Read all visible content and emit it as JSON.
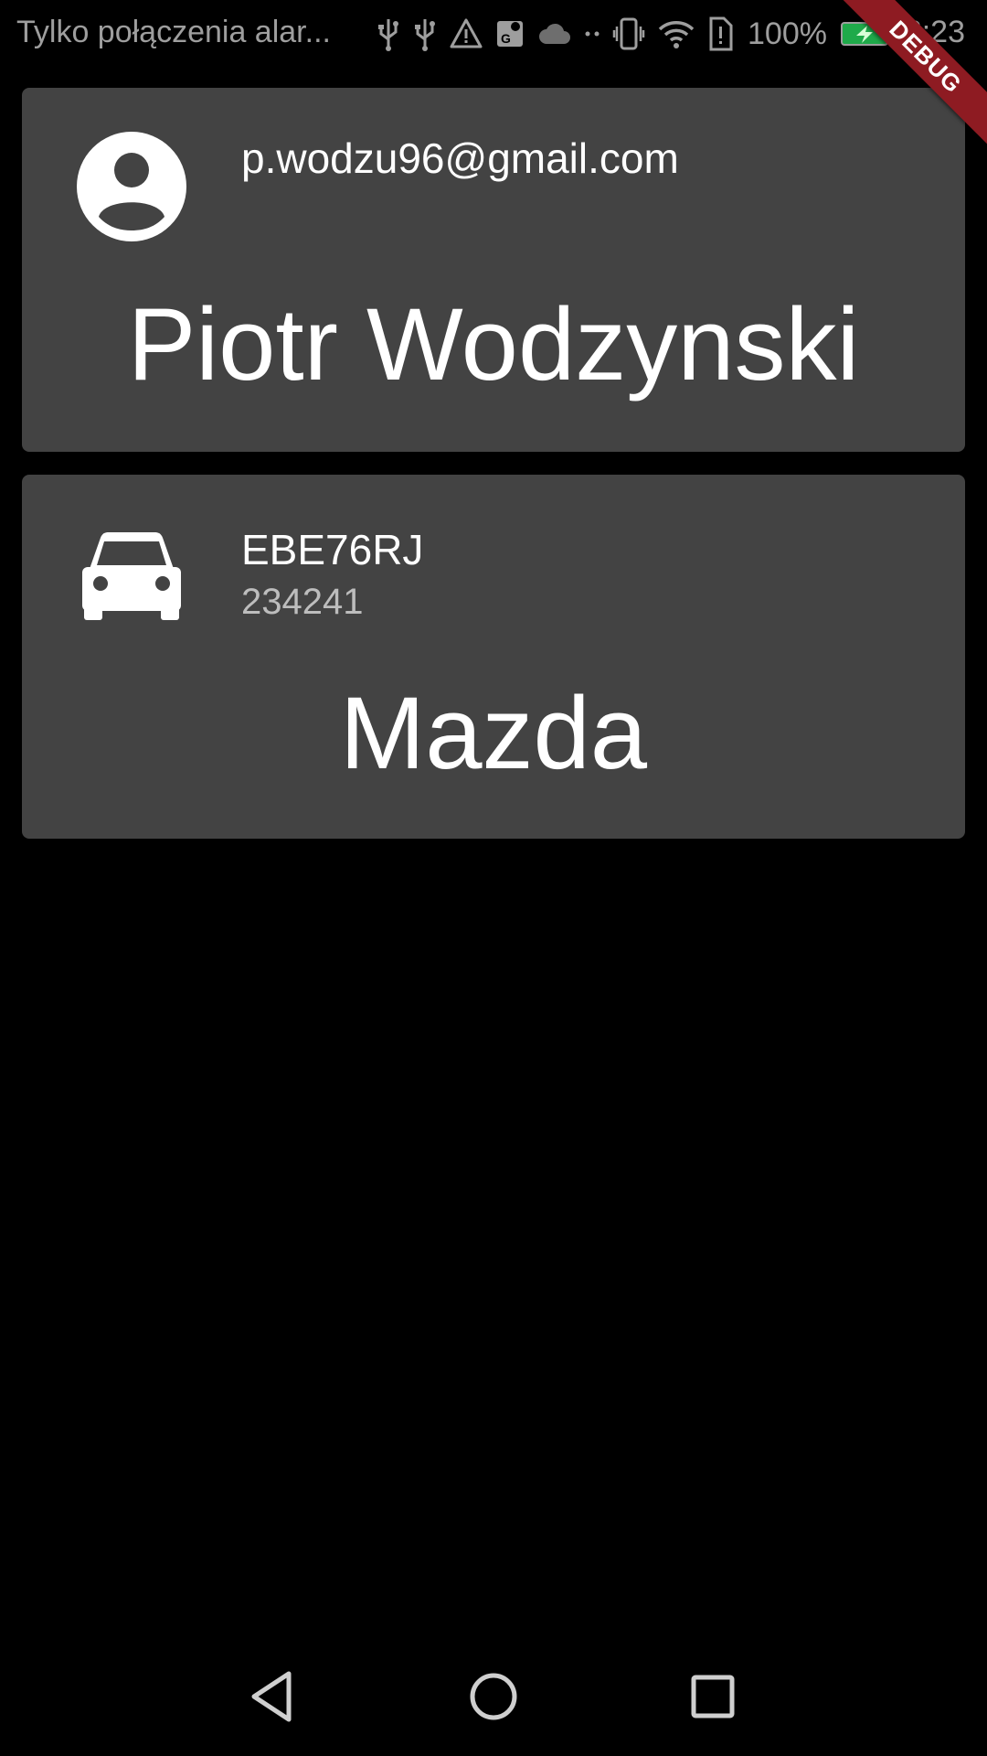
{
  "status_bar": {
    "notification_text": "Tylko połączenia alar...",
    "battery_percent": "100%",
    "time": "22:23",
    "icons": [
      "usb-icon",
      "usb-icon",
      "warning-icon",
      "maps-icon",
      "cloud-icon",
      "dots-icon",
      "vibrate-icon",
      "wifi-icon",
      "sim-alert-icon",
      "battery-icon"
    ],
    "battery_color": "#1faa4a"
  },
  "debug_banner": {
    "label": "DEBUG",
    "color": "#8e1b22"
  },
  "user_card": {
    "icon": "account-circle-icon",
    "email": "p.wodzu96@gmail.com",
    "name": "Piotr Wodzynski"
  },
  "car_card": {
    "icon": "car-icon",
    "plate": "EBE76RJ",
    "number": "234241",
    "make": "Mazda"
  },
  "nav_bar": {
    "buttons": [
      "back-icon",
      "home-icon",
      "recent-apps-icon"
    ]
  },
  "colors": {
    "background": "#000000",
    "card": "#434343",
    "text_primary": "#ffffff",
    "text_secondary": "#bdbdbd"
  }
}
